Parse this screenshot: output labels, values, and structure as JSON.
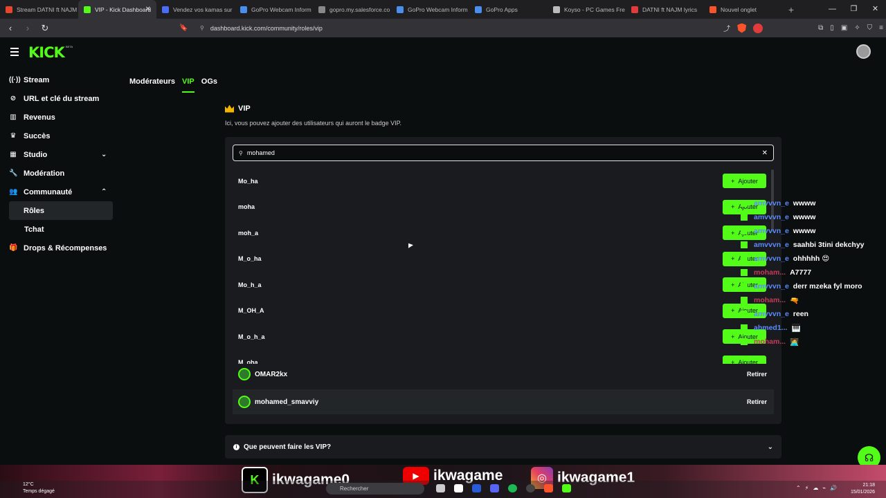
{
  "browser": {
    "tabs": [
      {
        "title": "Stream DATNI ft NAJM",
        "color": "#e8452c"
      },
      {
        "title": "VIP - Kick Dashboard",
        "color": "#53fc18"
      },
      {
        "title": "Vendez vos kamas sur",
        "color": "#4a6cf7"
      },
      {
        "title": "GoPro Webcam Inform",
        "color": "#4a8ff0"
      },
      {
        "title": "gopro.my.salesforce.co",
        "color": "#888888"
      },
      {
        "title": "GoPro Webcam Inform",
        "color": "#4a8ff0"
      },
      {
        "title": "GoPro Apps",
        "color": "#4a8ff0"
      },
      {
        "title": "Koyso - PC Games Fre",
        "color": "#bbbbbb"
      },
      {
        "title": "DATNI ft NAJM lyrics",
        "color": "#e23b3b"
      },
      {
        "title": "Nouvel onglet",
        "color": "#fb542b"
      }
    ],
    "url": "dashboard.kick.com/community/roles/vip"
  },
  "site": {
    "logo": "KICK",
    "logo_tag": "BETA"
  },
  "sidebar": {
    "items": [
      {
        "label": "Stream",
        "icon": "broadcast-icon"
      },
      {
        "label": "URL et clé du stream",
        "icon": "link-icon"
      },
      {
        "label": "Revenus",
        "icon": "chart-icon"
      },
      {
        "label": "Succès",
        "icon": "trophy-icon"
      },
      {
        "label": "Studio",
        "icon": "grid-icon"
      },
      {
        "label": "Modération",
        "icon": "wrench-icon"
      },
      {
        "label": "Communauté",
        "icon": "people-icon"
      },
      {
        "label": "Rôles",
        "icon": ""
      },
      {
        "label": "Tchat",
        "icon": ""
      },
      {
        "label": "Drops & Récompenses",
        "icon": "gift-icon"
      }
    ]
  },
  "roletabs": {
    "moderators": "Modérateurs",
    "vip": "VIP",
    "ogs": "OGs"
  },
  "vip": {
    "title": "VIP",
    "description": "Ici, vous pouvez ajouter des utilisateurs qui auront le badge VIP.",
    "search_value": "mohamed",
    "add_label": "Ajouter",
    "suggestions": [
      "Mo_ha",
      "moha",
      "moh_a",
      "M_o_ha",
      "Mo_h_a",
      "M_OH_A",
      "M_o_h_a",
      "M_oha"
    ],
    "members": [
      {
        "name": "OMAR2kx",
        "action": "Retirer"
      },
      {
        "name": "mohamed_smavviy",
        "action": "Retirer"
      }
    ],
    "faq": "Que peuvent faire les VIP?"
  },
  "chat": {
    "lines": [
      {
        "user": "amvvvn_e",
        "msg": "wwww",
        "color": "#5a8cff"
      },
      {
        "user": "amvvvn_e",
        "msg": "wwww",
        "color": "#5a8cff"
      },
      {
        "user": "amvvvn_e",
        "msg": "wwww",
        "color": "#5a8cff"
      },
      {
        "user": "amvvvn_e",
        "msg": "saahbi 3tini dekchyy",
        "color": "#5a8cff"
      },
      {
        "user": "amvvvn_e",
        "msg": "ohhhhh 😍",
        "color": "#5a8cff"
      },
      {
        "user": "moham...",
        "msg": "A7777",
        "color": "#c83a5a"
      },
      {
        "user": "amvvvn_e",
        "msg": "derr mzeka fyl moro",
        "color": "#5a8cff"
      },
      {
        "user": "moham...",
        "msg": "🔫",
        "color": "#c83a5a"
      },
      {
        "user": "amvvvn_e",
        "msg": "reen",
        "color": "#5a8cff"
      },
      {
        "user": "ahmed1...",
        "msg": "🎹",
        "color": "#5a8cff"
      },
      {
        "user": "moham...",
        "msg": "🧑‍💻",
        "color": "#c83a5a"
      }
    ]
  },
  "overlay": {
    "kick": "ikwagame0",
    "youtube": "ikwagame",
    "instagram": "ikwagame1"
  },
  "taskbar": {
    "temp": "12°C",
    "weather": "Temps dégagé",
    "search": "Rechercher",
    "time": "21:18",
    "date": "15/01/2026"
  }
}
